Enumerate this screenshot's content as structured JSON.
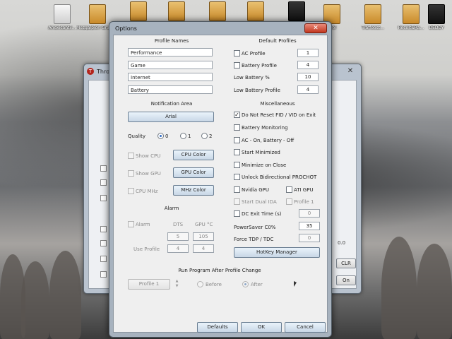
{
  "desktop": {
    "icons": [
      {
        "label": "Anexicantil...",
        "type": "doc"
      },
      {
        "label": "Mozgalpion Grace nore",
        "type": "folder"
      },
      {
        "label": "",
        "type": "folder"
      },
      {
        "label": "",
        "type": "folder"
      },
      {
        "label": "",
        "type": "folder"
      },
      {
        "label": "",
        "type": "folder"
      },
      {
        "label": "",
        "type": "blk"
      },
      {
        "label": "Tool",
        "type": "folder"
      },
      {
        "label": "Traffoost...",
        "type": "folder"
      },
      {
        "label": "Recolt&Ra...",
        "type": "folder"
      },
      {
        "label": "DEDDY",
        "type": "blk"
      }
    ]
  },
  "background_window": {
    "title": "Thro",
    "close_glyph": "✕",
    "visible_text": [
      "0.0",
      "CLR",
      "On"
    ]
  },
  "dialog": {
    "title": "Options",
    "close_glyph": "✕",
    "profile_names": {
      "header": "Profile Names",
      "names": [
        "Performance",
        "Game",
        "Internet",
        "Battery"
      ]
    },
    "default_profiles": {
      "header": "Default Profiles",
      "rows": [
        {
          "label": "AC Profile",
          "checkbox": true,
          "checked": false,
          "value": "1"
        },
        {
          "label": "Battery Profile",
          "checkbox": true,
          "checked": false,
          "value": "4"
        },
        {
          "label": "Low Battery %",
          "checkbox": false,
          "checked": false,
          "value": "10"
        },
        {
          "label": "Low Battery Profile",
          "checkbox": false,
          "checked": false,
          "value": "4"
        }
      ]
    },
    "notification_area": {
      "header": "Notification Area",
      "font_button": "Arial",
      "quality_label": "Quality",
      "quality_options": [
        "0",
        "1",
        "2"
      ],
      "quality_selected": "0",
      "show_cpu_label": "Show CPU",
      "cpu_color_button": "CPU Color",
      "show_gpu_label": "Show GPU",
      "gpu_color_button": "GPU Color",
      "cpu_mhz_label": "CPU MHz",
      "mhz_color_button": "MHz Color"
    },
    "alarm": {
      "header": "Alarm",
      "alarm_label": "Alarm",
      "col_dts": "DTS",
      "col_gpu": "GPU °C",
      "dts_value": "5",
      "gpu_value": "105",
      "use_profile_label": "Use Profile",
      "profile_dts": "4",
      "profile_gpu": "4"
    },
    "misc": {
      "header": "Miscellaneous",
      "do_not_reset": "Do Not Reset FID / VID on Exit",
      "do_not_reset_checked": true,
      "battery_monitoring": "Battery Monitoring",
      "ac_on_battery_off": "AC - On, Battery - Off",
      "start_minimized": "Start Minimized",
      "minimize_on_close": "Minimize on Close",
      "unlock_prochot": "Unlock Bidirectional PROCHOT",
      "nvidia_gpu": "Nvidia GPU",
      "ati_gpu": "ATI GPU",
      "start_dual_ida": "Start Dual IDA",
      "profile_1": "Profile 1",
      "dc_exit_time": "DC Exit Time (s)",
      "dc_exit_value": "0",
      "powersaver_label": "PowerSaver C0%",
      "powersaver_value": "35",
      "force_tdp_label": "Force TDP / TDC",
      "force_tdp_value": "0",
      "hotkey_button": "HotKey Manager"
    },
    "run_program": {
      "header": "Run Program After Profile Change",
      "profile_button": "Profile 1",
      "before_label": "Before",
      "after_label": "After",
      "selected": "After"
    },
    "footer": {
      "defaults": "Defaults",
      "ok": "OK",
      "cancel": "Cancel"
    }
  }
}
